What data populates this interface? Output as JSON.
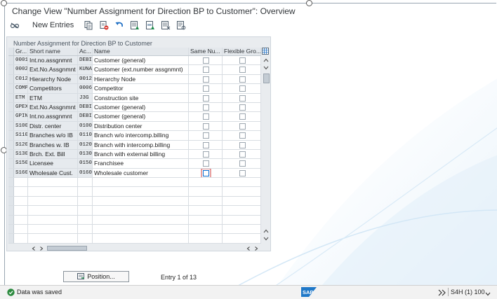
{
  "window": {
    "title": "Change View \"Number Assignment for Direction BP to Customer\": Overview"
  },
  "toolbar": {
    "new_entries_label": "New Entries",
    "icons": [
      "glasses-toggle-icon",
      "copy-icon",
      "delete-icon",
      "undo-icon",
      "select-all-icon",
      "select-block-icon",
      "deselect-all-icon",
      "details-icon"
    ]
  },
  "table": {
    "title": "Number Assignment for Direction BP to Customer",
    "columns": [
      "Gr...",
      "Short name",
      "Ac...",
      "Name",
      "Same Nu...",
      "Flexible Gro..."
    ],
    "rows": [
      {
        "grouping": "0001",
        "short_name": "Int.no.assgnmnt",
        "account_group": "DEBI",
        "name": "Customer (general)"
      },
      {
        "grouping": "0002",
        "short_name": "Ext.No.Assgnmnt",
        "account_group": "KUNA",
        "name": "Customer (ext.number assgnmnt)"
      },
      {
        "grouping": "C012",
        "short_name": "Hierarchy Node",
        "account_group": "0012",
        "name": "Hierarchy Node"
      },
      {
        "grouping": "COMP",
        "short_name": "Competitors",
        "account_group": "0006",
        "name": "Competitor"
      },
      {
        "grouping": "ETM",
        "short_name": "ETM",
        "account_group": "J3G",
        "name": "Construction site"
      },
      {
        "grouping": "GPEX",
        "short_name": "Ext.No.Assgnmnt",
        "account_group": "DEBI",
        "name": "Customer (general)"
      },
      {
        "grouping": "GPIN",
        "short_name": "Int.no.assgnmnt",
        "account_group": "DEBI",
        "name": "Customer (general)"
      },
      {
        "grouping": "S100",
        "short_name": "Distr. center",
        "account_group": "0100",
        "name": "Distribution center"
      },
      {
        "grouping": "S110",
        "short_name": "Branches w/o IB",
        "account_group": "0110",
        "name": "Branch w/o intercomp.billing"
      },
      {
        "grouping": "S120",
        "short_name": "Branches w. IB",
        "account_group": "0120",
        "name": "Branch with intercomp.billing"
      },
      {
        "grouping": "S130",
        "short_name": "Brch. Ext. Bill",
        "account_group": "0130",
        "name": "Branch with external billing"
      },
      {
        "grouping": "S150",
        "short_name": "Licensee",
        "account_group": "0150",
        "name": "Franchisee"
      },
      {
        "grouping": "S160",
        "short_name": "Wholesale Cust.",
        "account_group": "0160",
        "name": "Wholesale customer"
      }
    ]
  },
  "footer": {
    "position_label": "Position...",
    "entry_text": "Entry 1 of 13"
  },
  "status": {
    "message": "Data was saved",
    "system_info": "S4H (1) 100"
  },
  "colors": {
    "success": "#2b8a3e",
    "sap_blue": "#1f78c8",
    "focus": "#0a6ed1"
  }
}
